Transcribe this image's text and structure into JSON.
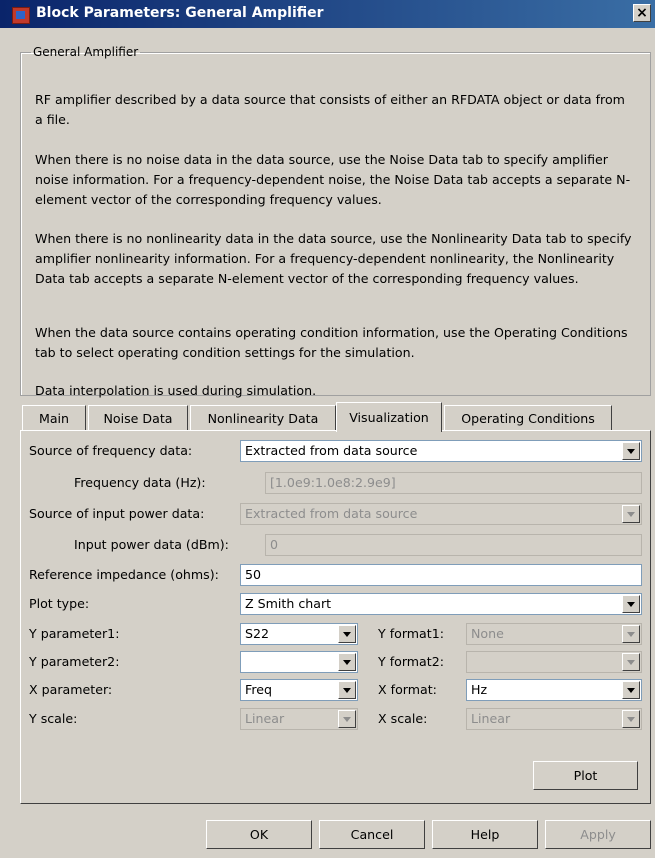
{
  "window": {
    "title": "Block Parameters: General Amplifier",
    "close_label": "×"
  },
  "description": {
    "legend": "General Amplifier",
    "paragraphs": [
      "RF amplifier described by a data source that consists of either an RFDATA object or data from a file.",
      "When there is no noise data in the data source, use the Noise Data tab to specify amplifier noise information. For a frequency-dependent noise, the Noise Data tab accepts a separate N-element vector of the corresponding frequency values.",
      "When there is no nonlinearity data in the data source, use the Nonlinearity Data tab to specify amplifier nonlinearity information. For a frequency-dependent nonlinearity, the Nonlinearity Data tab accepts a separate N-element vector of the corresponding frequency values.",
      "When the data source contains operating condition information, use the Operating Conditions tab to select operating condition settings for the simulation.",
      "Data interpolation is used during simulation."
    ]
  },
  "tabs": [
    "Main",
    "Noise Data",
    "Nonlinearity Data",
    "Visualization",
    "Operating Conditions"
  ],
  "active_tab": "Visualization",
  "form": {
    "source_freq": {
      "label": "Source of frequency data:",
      "value": "Extracted from data source"
    },
    "freq_data": {
      "label": "Frequency data (Hz):",
      "value": "[1.0e9:1.0e8:2.9e9]"
    },
    "source_power": {
      "label": "Source of input power data:",
      "value": "Extracted from data source"
    },
    "power_data": {
      "label": "Input power data (dBm):",
      "value": "0"
    },
    "ref_impedance": {
      "label": "Reference impedance (ohms):",
      "value": "50"
    },
    "plot_type": {
      "label": "Plot type:",
      "value": "Z Smith chart"
    },
    "y_param1": {
      "label": "Y parameter1:",
      "value": "S22"
    },
    "y_format1": {
      "label": "Y format1:",
      "value": "None"
    },
    "y_param2": {
      "label": "Y parameter2:",
      "value": ""
    },
    "y_format2": {
      "label": "Y format2:",
      "value": ""
    },
    "x_param": {
      "label": "X parameter:",
      "value": "Freq"
    },
    "x_format": {
      "label": "X format:",
      "value": "Hz"
    },
    "y_scale": {
      "label": "Y scale:",
      "value": "Linear"
    },
    "x_scale": {
      "label": "X scale:",
      "value": "Linear"
    }
  },
  "buttons": {
    "plot": "Plot",
    "ok": "OK",
    "cancel": "Cancel",
    "help": "Help",
    "apply": "Apply"
  }
}
